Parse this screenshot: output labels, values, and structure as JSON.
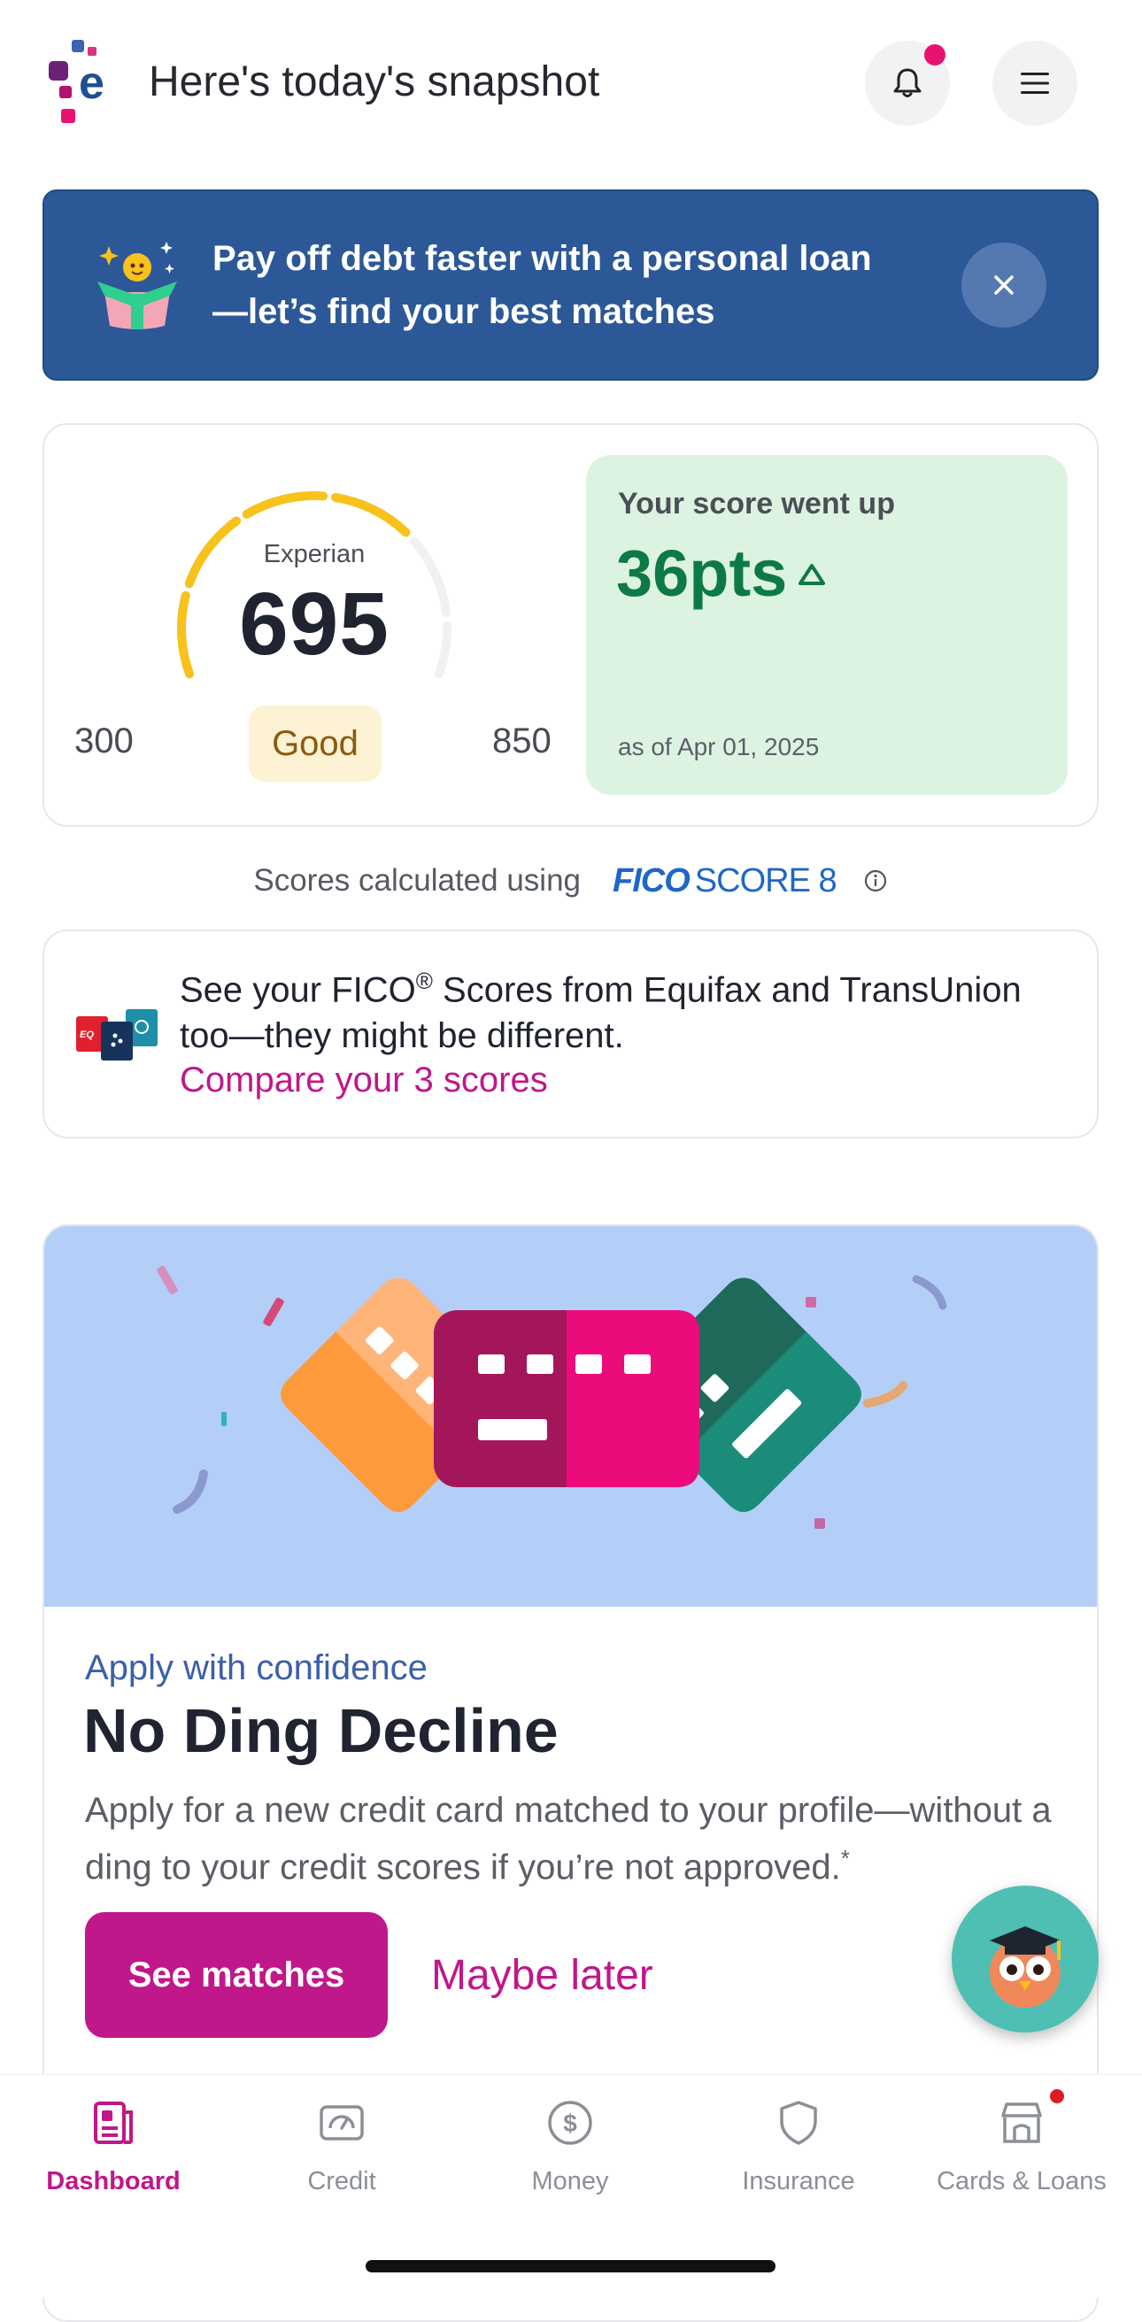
{
  "header": {
    "title": "Here's today's snapshot",
    "logo_icon": "experian-logo",
    "notifications_icon": "bell-icon",
    "menu_icon": "hamburger-menu-icon",
    "has_unread": true
  },
  "promo": {
    "text": "Pay off debt faster with a personal loan —let’s find your best matches",
    "close_icon": "close-icon",
    "illustration_icon": "gift-box-star-icon"
  },
  "score": {
    "bureau": "Experian",
    "value": "695",
    "range_min": "300",
    "range_max": "850",
    "rating": "Good",
    "change_label": "Your score went up",
    "change_value": "36pts",
    "change_date": "as of Apr 01, 2025",
    "colors": {
      "gauge": "#f7c21b",
      "change": "#0d7a45"
    }
  },
  "fico": {
    "prefix": "Scores calculated using",
    "brand_bold": "FICO",
    "brand_light": "SCORE 8"
  },
  "compare": {
    "text_before": "See your FICO",
    "registered": "®",
    "text_after": " Scores from Equifax and TransUnion too—they might be different.",
    "link": "Compare your 3 scores"
  },
  "offer": {
    "eyebrow": "Apply with confidence",
    "title": "No Ding Decline",
    "body": "Apply for a new credit card matched to your profile—without a ding to your credit scores if you’re not approved.",
    "asterisk": "*",
    "primary_button": "See matches",
    "secondary_button": "Maybe later"
  },
  "assistant": {
    "icon": "owl-graduate-icon"
  },
  "nav": {
    "items": [
      {
        "label": "Dashboard",
        "icon": "dashboard-icon",
        "active": true
      },
      {
        "label": "Credit",
        "icon": "credit-icon",
        "active": false
      },
      {
        "label": "Money",
        "icon": "dollar-icon",
        "active": false
      },
      {
        "label": "Insurance",
        "icon": "shield-icon",
        "active": false
      },
      {
        "label": "Cards & Loans",
        "icon": "storefront-icon",
        "active": false,
        "badge": true
      }
    ]
  },
  "colors": {
    "accent": "#c0178a",
    "banner": "#2c5898",
    "art_bg": "#b4cff7"
  }
}
